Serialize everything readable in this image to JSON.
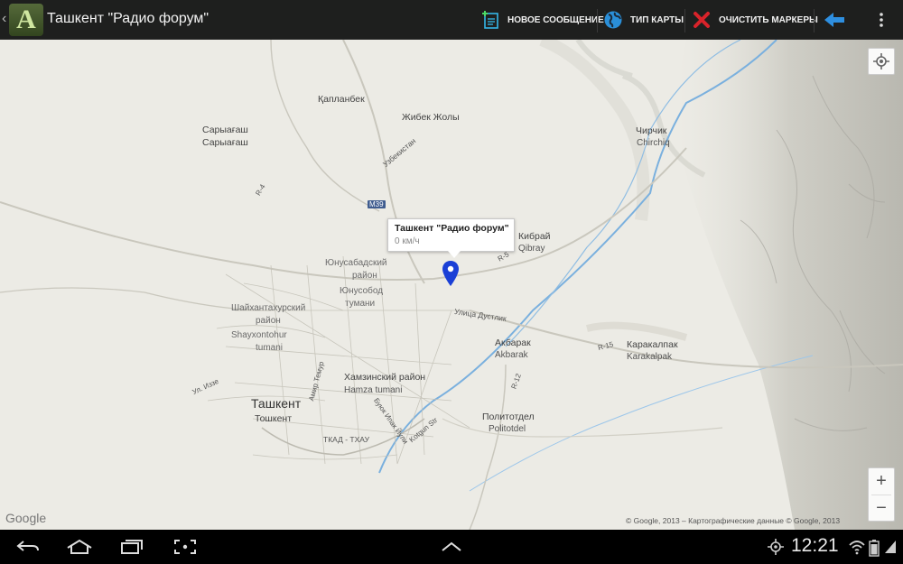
{
  "app": {
    "title": "Ташкент \"Радио форум\"",
    "logo_letter": "A"
  },
  "actions": {
    "new_message": "НОВОЕ СООБЩЕНИЕ",
    "map_type": "ТИП КАРТЫ",
    "clear_markers": "ОЧИСТИТЬ МАРКЕРЫ"
  },
  "map": {
    "infowindow": {
      "title": "Ташкент \"Радио форум\"",
      "speed": "0 км/ч"
    },
    "labels": {
      "kaplanbek": "Қапланбек",
      "zhibek_zholy": "Жибек Жолы",
      "saryagash_1": "Сарыағаш",
      "saryagash_2": "Сарыағаш",
      "chirchik_ru": "Чирчик",
      "chirchik_uz": "Chirchiq",
      "kibray_ru": "Кибрай",
      "kibray_uz": "Qibray",
      "yunusabad_ru_1": "Юнусабадский",
      "yunusabad_ru_2": "район",
      "yunusabad_uz_1": "Юнусобод",
      "yunusabad_uz_2": "тумани",
      "shaykhantakhur_ru_1": "Шайхантахурский",
      "shaykhantakhur_ru_2": "район",
      "shaykhantakhur_uz_1": "Shayxontohur",
      "shaykhantakhur_uz_2": "tumani",
      "khamza_ru": "Хамзинский район",
      "khamza_uz": "Hamza tumani",
      "tashkent_ru": "Ташкент",
      "tashkent_uz": "Тошкент",
      "akbarak_ru": "Акбарак",
      "akbarak_uz": "Akbarak",
      "karakalpak_ru": "Каракалпак",
      "karakalpak_uz": "Karakalpak",
      "politotdel_ru": "Политотдел",
      "politotdel_uz": "Politotdel",
      "dustlik": "Улица Дустлик",
      "uzbekistan_road": "Узбекистан",
      "r4": "R-4",
      "r5": "R-5",
      "r12": "R-12",
      "r15": "R-15",
      "m39": "M39",
      "tkad": "ТКАД - ТХАУ",
      "amir_temur": "Амир Темур",
      "buyuk_ipak": "Буюк Ипак Йули",
      "ulitsa_ibrata": "Ул. Иззе",
      "kotgun": "Kotgun Str"
    },
    "google_logo": "Google",
    "copyright": "© Google, 2013 – Картографические данные © Google, 2013",
    "zoom_in": "+",
    "zoom_out": "−"
  },
  "statusbar": {
    "clock": "12:21"
  },
  "icons": {
    "new_message": "new-message-icon",
    "map_type": "globe-icon",
    "clear_markers": "red-x-icon",
    "back": "blue-arrow-left-icon",
    "overflow": "overflow-menu-icon",
    "locate": "my-location-icon",
    "pin": "map-pin-icon"
  },
  "colors": {
    "actionbar": "#1e1f1e",
    "map_bg": "#ecebe5",
    "pin": "#1a3fd6",
    "back_arrow": "#2e8fe0",
    "clear_x": "#d8232a"
  }
}
